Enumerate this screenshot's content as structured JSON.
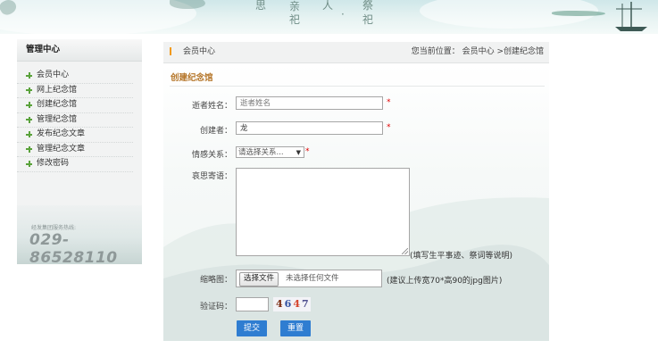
{
  "banner": {
    "chars": [
      "思",
      "亲",
      "人",
      "·",
      "祭",
      "祀",
      "祀"
    ]
  },
  "sidebar": {
    "title": "管理中心",
    "items": [
      {
        "label": "会员中心"
      },
      {
        "label": "网上纪念馆"
      },
      {
        "label": "创建纪念馆"
      },
      {
        "label": "管理纪念馆"
      },
      {
        "label": "发布纪念文章"
      },
      {
        "label": "管理纪念文章"
      },
      {
        "label": "修改密码"
      }
    ],
    "hotline_label": "经发集团服务热线:",
    "hotline_number": "029-86528110"
  },
  "header": {
    "section": "会员中心",
    "breadcrumb": "您当前位置： 会员中心 >创建纪念馆"
  },
  "form": {
    "title": "创建纪念馆",
    "deceased_label": "逝者姓名：",
    "deceased_placeholder": "逝者姓名",
    "creator_label": "创建者：",
    "creator_value": "龙",
    "relation_label": "情感关系：",
    "relation_selected": "请选择关系...",
    "message_label": "哀思寄语：",
    "message_hint": "(填写生平事迹、祭词等说明)",
    "thumb_label": "缩略图：",
    "file_button": "选择文件",
    "file_status": "未选择任何文件",
    "thumb_hint": "(建议上传宽70*高90的jpg图片)",
    "captcha_label": "验证码：",
    "captcha_digits": [
      "4",
      "6",
      "4",
      "7"
    ],
    "captcha_colors": [
      "#7a2a10",
      "#2f4fa0",
      "#d5432c",
      "#4b4b8d"
    ],
    "required_mark": "*",
    "submit": "提交",
    "reset": "重置"
  }
}
